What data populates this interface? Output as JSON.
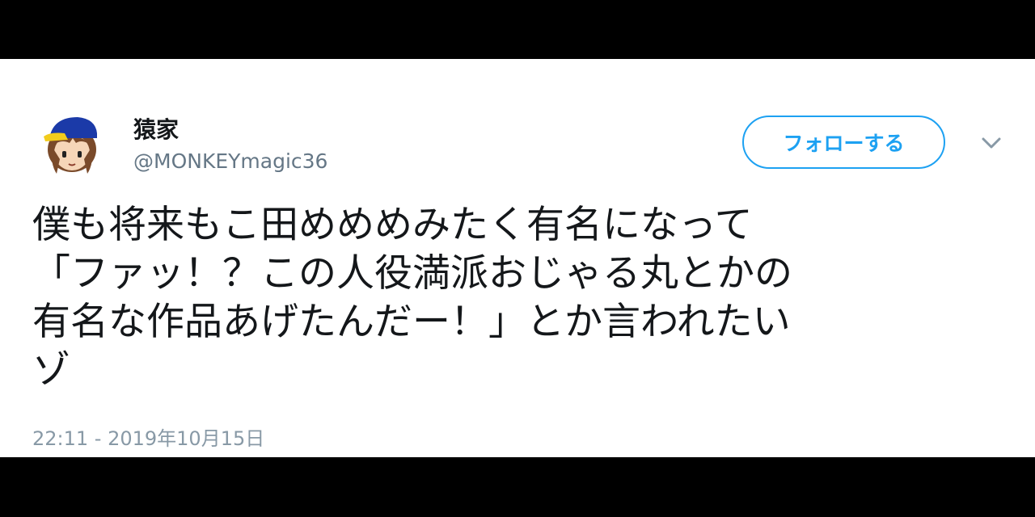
{
  "user": {
    "display_name": "猿家",
    "handle": "@MONKEYmagic36",
    "avatar_icon": "character-avatar-icon"
  },
  "actions": {
    "follow_label": "フォローする",
    "menu_icon": "chevron-down-icon"
  },
  "tweet": {
    "text": "僕も将来もこ田めめめみたく有名になって\n「ファッ！？この人役満派おじゃる丸とかの\n有名な作品あげたんだー！」とか言われたい\nゾ",
    "timestamp": "22:11 - 2019年10月15日"
  },
  "colors": {
    "accent": "#1da1f2",
    "text": "#14171a",
    "muted": "#657786",
    "letterbox": "#000000"
  }
}
